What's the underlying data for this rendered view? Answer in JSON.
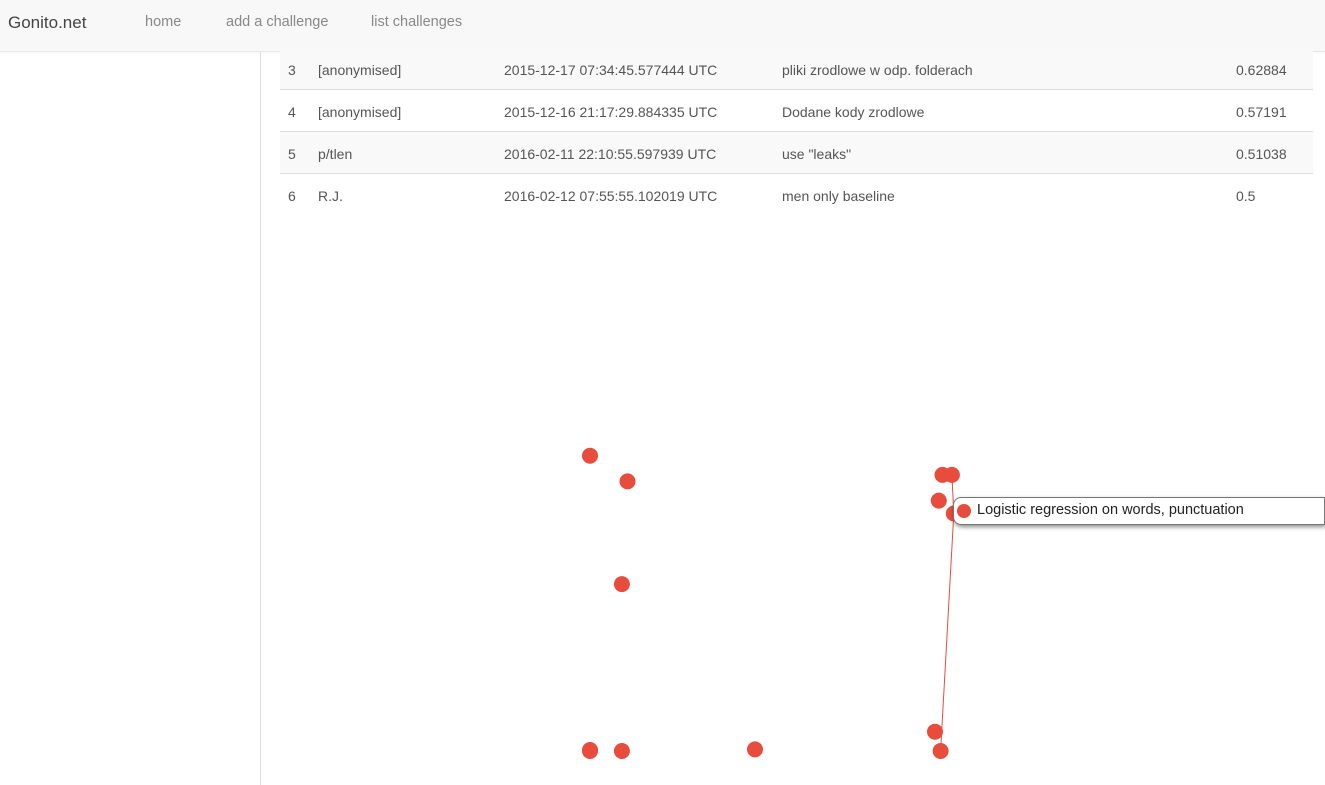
{
  "navbar": {
    "brand": "Gonito.net",
    "links": [
      "home",
      "add a challenge",
      "list challenges"
    ]
  },
  "leaderboard": {
    "rows": [
      {
        "rank": "3",
        "submitter": "[anonymised]",
        "when": "2015-12-17 07:34:45.577444 UTC",
        "description": "pliki zrodlowe w odp. folderach",
        "score": "0.62884"
      },
      {
        "rank": "4",
        "submitter": "[anonymised]",
        "when": "2015-12-16 21:17:29.884335 UTC",
        "description": "Dodane kody zrodlowe",
        "score": "0.57191"
      },
      {
        "rank": "5",
        "submitter": "p/tlen",
        "when": "2016-02-11 22:10:55.597939 UTC",
        "description": "use \"leaks\"",
        "score": "0.51038"
      },
      {
        "rank": "6",
        "submitter": "R.J.",
        "when": "2016-02-12 07:55:55.102019 UTC",
        "description": "men only baseline",
        "score": "0.5"
      }
    ]
  },
  "chart_data": {
    "type": "scatter",
    "title": "",
    "xlabel": "",
    "ylabel": "",
    "marker_color": "#e74c3c",
    "line_color": "#e74c3c",
    "points": [
      {
        "x": 0.0,
        "y": 0.92
      },
      {
        "x": 0.1,
        "y": 0.84
      },
      {
        "x": 0.085,
        "y": 0.52
      },
      {
        "x": 0.0,
        "y": 0.0
      },
      {
        "x": 0.0,
        "y": 0.003
      },
      {
        "x": 0.085,
        "y": 0.0
      },
      {
        "x": 0.44,
        "y": 0.005
      },
      {
        "x": 0.94,
        "y": 0.86
      },
      {
        "x": 0.965,
        "y": 0.86
      },
      {
        "x": 0.93,
        "y": 0.78
      },
      {
        "x": 0.97,
        "y": 0.74
      },
      {
        "x": 0.92,
        "y": 0.06
      },
      {
        "x": 0.935,
        "y": 0.0
      }
    ],
    "line": [
      {
        "x": 0.965,
        "y": 0.86
      },
      {
        "x": 0.97,
        "y": 0.74
      },
      {
        "x": 0.935,
        "y": 0.0
      }
    ],
    "tooltip": "Logistic regression on words, punctuation"
  }
}
